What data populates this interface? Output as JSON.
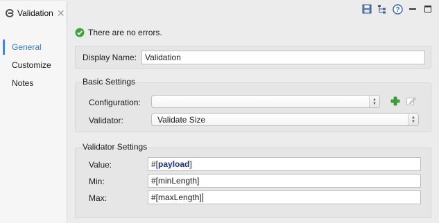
{
  "tab": {
    "title": "Validation",
    "close": "✕"
  },
  "toolbar": {
    "icons": [
      "save-icon",
      "tree-icon",
      "help-icon",
      "minimize-icon",
      "maximize-icon"
    ]
  },
  "nav": {
    "items": [
      {
        "label": "General",
        "active": true
      },
      {
        "label": "Customize"
      },
      {
        "label": "Notes"
      }
    ]
  },
  "status": {
    "message": "There are no errors."
  },
  "display": {
    "label": "Display Name:",
    "value": "Validation"
  },
  "basic": {
    "title": "Basic Settings",
    "configuration_label": "Configuration:",
    "configuration_value": "",
    "validator_label": "Validator:",
    "validator_value": "Validate Size"
  },
  "validator_settings": {
    "title": "Validator Settings",
    "value_label": "Value:",
    "value_prefix": "#[",
    "value_keyword": "payload",
    "value_suffix": "]",
    "min_label": "Min:",
    "min_value": "#[minLength]",
    "max_label": "Max:",
    "max_value": "#[maxLength]"
  },
  "colors": {
    "accent": "#3a78c2",
    "ok": "#3aa53a",
    "add": "#3aa53a"
  }
}
